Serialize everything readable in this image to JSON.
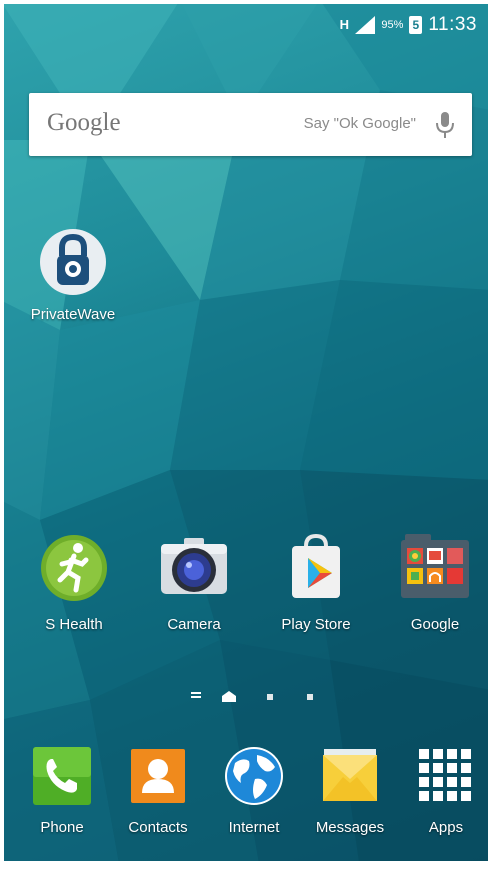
{
  "status_bar": {
    "network": "H",
    "battery": "95%",
    "battery_badge": "5",
    "time": "11:33"
  },
  "search_widget": {
    "logo": "Google",
    "hint": "Say \"Ok Google\""
  },
  "desktop_apps": [
    {
      "label": "PrivateWave",
      "icon": "lock-phone-icon"
    }
  ],
  "home_row": [
    {
      "label": "S Health",
      "icon": "runner-icon"
    },
    {
      "label": "Camera",
      "icon": "camera-icon"
    },
    {
      "label": "Play Store",
      "icon": "play-store-icon"
    },
    {
      "label": "Google",
      "icon": "google-folder-icon"
    }
  ],
  "page_indicator": {
    "pages": 4,
    "current": 2
  },
  "dock": [
    {
      "label": "Phone",
      "icon": "phone-icon"
    },
    {
      "label": "Contacts",
      "icon": "contacts-icon"
    },
    {
      "label": "Internet",
      "icon": "globe-icon"
    },
    {
      "label": "Messages",
      "icon": "envelope-icon"
    },
    {
      "label": "Apps",
      "icon": "grid-icon"
    }
  ],
  "colors": {
    "wallpaper_light": "#2fa3ad",
    "wallpaper_dark": "#0a4f63",
    "phone_green": "#5bbf2a",
    "contacts_orange": "#f08a1c",
    "messages_yellow": "#f7cf3a",
    "shealth_green": "#8cc63f"
  }
}
